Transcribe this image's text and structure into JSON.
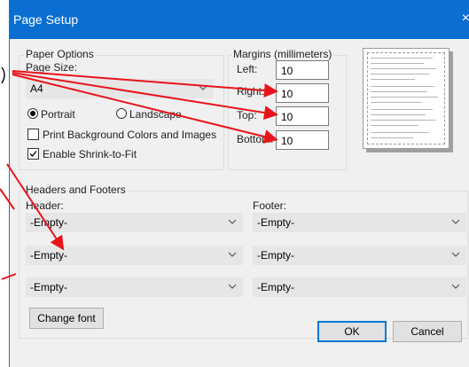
{
  "window": {
    "title": "Page Setup",
    "close_glyph": "×"
  },
  "paper_options": {
    "legend": "Paper Options",
    "page_size_label": "Page Size:",
    "page_size_value": "A4",
    "portrait_label": "Portrait",
    "landscape_label": "Landscape",
    "orientation_selected": "Portrait",
    "print_background_label": "Print Background Colors and Images",
    "print_background_checked": false,
    "shrink_to_fit_label": "Enable Shrink-to-Fit",
    "shrink_to_fit_checked": true
  },
  "margins": {
    "legend": "Margins (millimeters)",
    "left_label": "Left:",
    "left_value": "10",
    "right_label": "Right:",
    "right_value": "10",
    "top_label": "Top:",
    "top_value": "10",
    "bottom_label": "Bottom:",
    "bottom_value": "10"
  },
  "headers_footers": {
    "legend": "Headers and Footers",
    "header_label": "Header:",
    "footer_label": "Footer:",
    "header_values": [
      "-Empty-",
      "-Empty-",
      "-Empty-"
    ],
    "footer_values": [
      "-Empty-",
      "-Empty-",
      "-Empty-"
    ],
    "change_font_label": "Change font"
  },
  "buttons": {
    "ok_label": "OK",
    "cancel_label": "Cancel"
  },
  "colors": {
    "titlebar": "#0a6fd1",
    "annotation_arrows": "#e8141b",
    "dialog_background": "#f0f0f0"
  },
  "icons": {
    "dropdown": "chevron-down-icon",
    "check": "checkmark-icon"
  }
}
